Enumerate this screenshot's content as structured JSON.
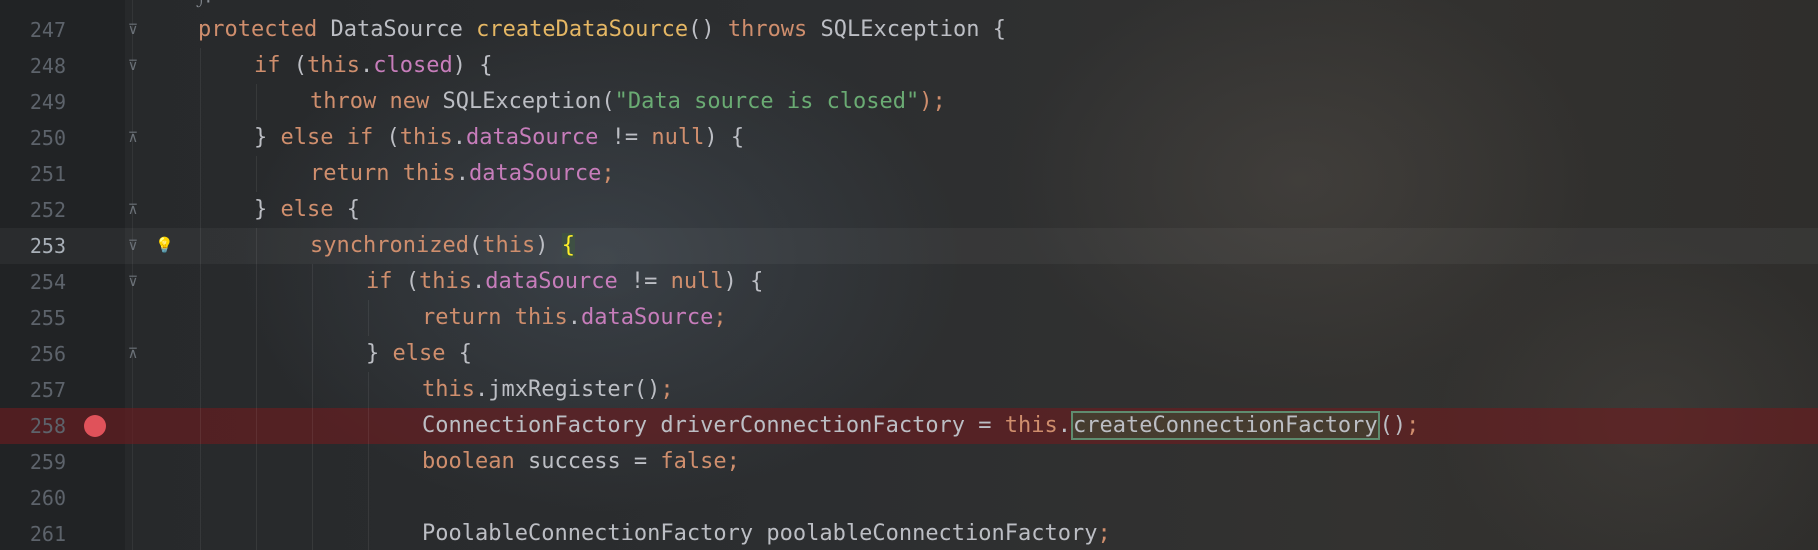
{
  "editor": {
    "lines": [
      {
        "num": "247",
        "fold": "open",
        "indent": 0,
        "tokens": [
          {
            "t": "protected ",
            "c": "kw"
          },
          {
            "t": "DataSource ",
            "c": "op"
          },
          {
            "t": "createDataSource",
            "c": "decl"
          },
          {
            "t": "() ",
            "c": "op"
          },
          {
            "t": "throws ",
            "c": "kw"
          },
          {
            "t": "SQLException {",
            "c": "op"
          }
        ]
      },
      {
        "num": "248",
        "fold": "open",
        "indent": 1,
        "tokens": [
          {
            "t": "if ",
            "c": "kw"
          },
          {
            "t": "(",
            "c": "op"
          },
          {
            "t": "this",
            "c": "kw"
          },
          {
            "t": ".",
            "c": "op"
          },
          {
            "t": "closed",
            "c": "fld"
          },
          {
            "t": ") {",
            "c": "op"
          }
        ]
      },
      {
        "num": "249",
        "fold": "",
        "indent": 2,
        "tokens": [
          {
            "t": "throw new ",
            "c": "kw"
          },
          {
            "t": "SQLException(",
            "c": "op"
          },
          {
            "t": "\"Data source is closed\"",
            "c": "str"
          },
          {
            "t": ");",
            "c": "kw"
          }
        ]
      },
      {
        "num": "250",
        "fold": "close",
        "indent": 1,
        "tokens": [
          {
            "t": "} ",
            "c": "op"
          },
          {
            "t": "else if ",
            "c": "kw"
          },
          {
            "t": "(",
            "c": "op"
          },
          {
            "t": "this",
            "c": "kw"
          },
          {
            "t": ".",
            "c": "op"
          },
          {
            "t": "dataSource",
            "c": "fld"
          },
          {
            "t": " != ",
            "c": "op"
          },
          {
            "t": "null",
            "c": "kw"
          },
          {
            "t": ") {",
            "c": "op"
          }
        ]
      },
      {
        "num": "251",
        "fold": "",
        "indent": 2,
        "tokens": [
          {
            "t": "return this",
            "c": "kw"
          },
          {
            "t": ".",
            "c": "op"
          },
          {
            "t": "dataSource",
            "c": "fld"
          },
          {
            "t": ";",
            "c": "kw"
          }
        ]
      },
      {
        "num": "252",
        "fold": "close",
        "indent": 1,
        "tokens": [
          {
            "t": "} ",
            "c": "op"
          },
          {
            "t": "else ",
            "c": "kw"
          },
          {
            "t": "{",
            "c": "op"
          }
        ]
      },
      {
        "num": "253",
        "fold": "open",
        "indent": 2,
        "current": true,
        "bulb": true,
        "tokens": [
          {
            "t": "synchronized",
            "c": "kw"
          },
          {
            "t": "(",
            "c": "op"
          },
          {
            "t": "this",
            "c": "kw"
          },
          {
            "t": ") ",
            "c": "op"
          },
          {
            "t": "{",
            "c": "br-hl"
          }
        ]
      },
      {
        "num": "254",
        "fold": "open",
        "indent": 3,
        "tokens": [
          {
            "t": "if ",
            "c": "kw"
          },
          {
            "t": "(",
            "c": "op"
          },
          {
            "t": "this",
            "c": "kw"
          },
          {
            "t": ".",
            "c": "op"
          },
          {
            "t": "dataSource",
            "c": "fld"
          },
          {
            "t": " != ",
            "c": "op"
          },
          {
            "t": "null",
            "c": "kw"
          },
          {
            "t": ") {",
            "c": "op"
          }
        ]
      },
      {
        "num": "255",
        "fold": "",
        "indent": 4,
        "tokens": [
          {
            "t": "return this",
            "c": "kw"
          },
          {
            "t": ".",
            "c": "op"
          },
          {
            "t": "dataSource",
            "c": "fld"
          },
          {
            "t": ";",
            "c": "kw"
          }
        ]
      },
      {
        "num": "256",
        "fold": "close",
        "indent": 3,
        "tokens": [
          {
            "t": "} ",
            "c": "op"
          },
          {
            "t": "else ",
            "c": "kw"
          },
          {
            "t": "{",
            "c": "op"
          }
        ]
      },
      {
        "num": "257",
        "fold": "",
        "indent": 4,
        "tokens": [
          {
            "t": "this",
            "c": "kw"
          },
          {
            "t": ".jmxRegister()",
            "c": "op"
          },
          {
            "t": ";",
            "c": "kw"
          }
        ]
      },
      {
        "num": "258",
        "fold": "",
        "indent": 4,
        "breakpoint": true,
        "tokens": [
          {
            "t": "ConnectionFactory driverConnectionFactory = ",
            "c": "op"
          },
          {
            "t": "this",
            "c": "kw"
          },
          {
            "t": ".",
            "c": "op"
          },
          {
            "t": "createConnectionFactory",
            "c": "sel-box"
          },
          {
            "t": "()",
            "c": "op"
          },
          {
            "t": ";",
            "c": "kw"
          }
        ]
      },
      {
        "num": "259",
        "fold": "",
        "indent": 4,
        "tokens": [
          {
            "t": "boolean ",
            "c": "kw"
          },
          {
            "t": "success = ",
            "c": "op"
          },
          {
            "t": "false",
            "c": "kw"
          },
          {
            "t": ";",
            "c": "kw"
          }
        ]
      },
      {
        "num": "260",
        "fold": "",
        "indent": 4,
        "tokens": []
      },
      {
        "num": "261",
        "fold": "",
        "indent": 4,
        "tokens": [
          {
            "t": "PoolableConnectionFactory poolableConnectionFactory",
            "c": "op"
          },
          {
            "t": ";",
            "c": "kw"
          }
        ]
      }
    ]
  },
  "icons": {
    "fold_open": "fold-open-icon",
    "fold_close": "fold-close-icon",
    "bulb": "lightbulb-icon",
    "breakpoint": "breakpoint-icon"
  },
  "colors": {
    "keyword": "#cf8e6d",
    "method_decl": "#e5b764",
    "field": "#c77dbb",
    "string": "#6aab73",
    "breakpoint": "#e0525a",
    "bulb": "#e8b43a"
  }
}
